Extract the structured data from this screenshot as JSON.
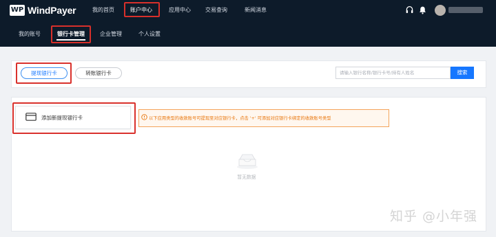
{
  "app": {
    "logo_mark": "WP",
    "logo_text": "WindPayer"
  },
  "topnav": {
    "items": [
      {
        "label": "我的首页"
      },
      {
        "label": "账户中心"
      },
      {
        "label": "应用中心"
      },
      {
        "label": "交易查询"
      },
      {
        "label": "新闻消息"
      }
    ],
    "active": "账户中心",
    "icons": [
      "headset-icon",
      "bell-icon"
    ]
  },
  "subnav": {
    "items": [
      {
        "label": "我的账号"
      },
      {
        "label": "银行卡管理"
      },
      {
        "label": "企业管理"
      },
      {
        "label": "个人设置"
      }
    ],
    "active": "银行卡管理"
  },
  "tabs": {
    "withdraw_card": "提现银行卡",
    "transfer_card": "转账银行卡"
  },
  "search": {
    "placeholder": "请输入银行名称/银行卡号/持有人姓名",
    "button": "搜索"
  },
  "add_card": {
    "label": "添加新提现银行卡"
  },
  "notice": {
    "text": "以下应用类型的收款账号可提现至对应银行卡，点击 '+' 可添加对应银行卡绑定的收款账号类型"
  },
  "empty_state": {
    "label": "暂无数据"
  },
  "watermark": {
    "text": "知乎 @小年强"
  },
  "colors": {
    "nav_bg": "#0d1b2a",
    "accent": "#1677ff",
    "highlight": "#d9302b",
    "warning": "#e8760c"
  }
}
